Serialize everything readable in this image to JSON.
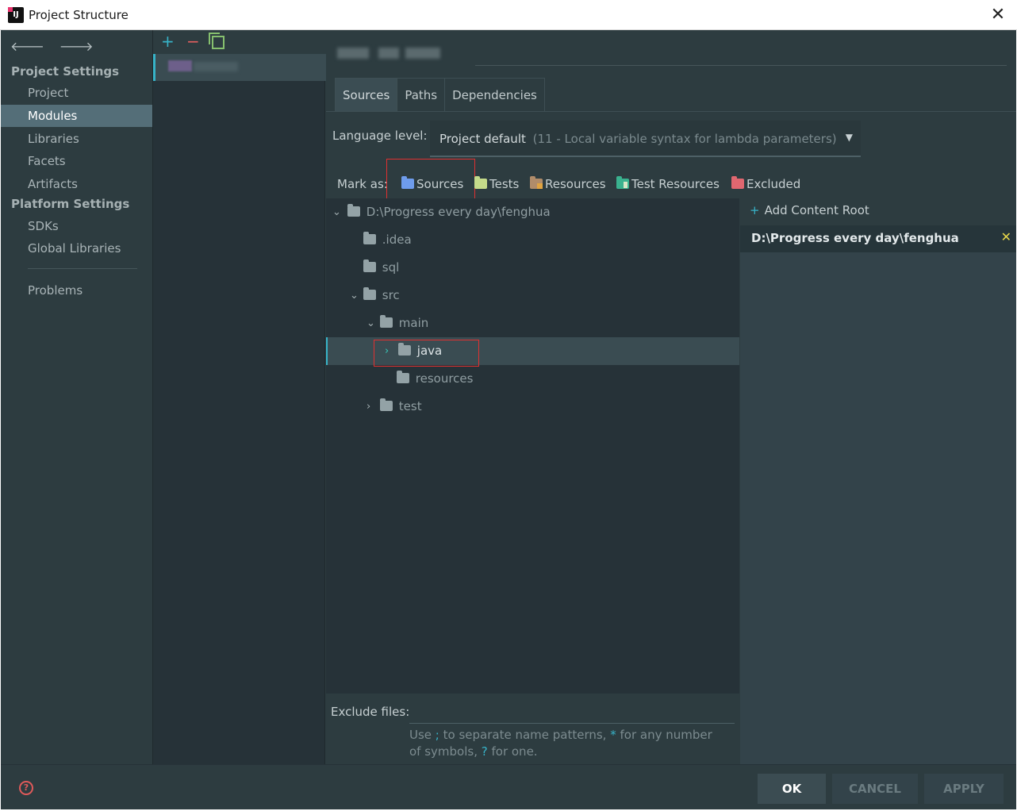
{
  "window": {
    "title": "Project Structure"
  },
  "nav": {
    "project_settings_header": "Project Settings",
    "platform_settings_header": "Platform Settings",
    "items": [
      {
        "label": "Project"
      },
      {
        "label": "Modules",
        "selected": true
      },
      {
        "label": "Libraries"
      },
      {
        "label": "Facets"
      },
      {
        "label": "Artifacts"
      },
      {
        "label": "SDKs"
      },
      {
        "label": "Global Libraries"
      },
      {
        "label": "Problems"
      }
    ]
  },
  "tabs": [
    {
      "label": "Sources",
      "active": true
    },
    {
      "label": "Paths"
    },
    {
      "label": "Dependencies"
    }
  ],
  "language_level": {
    "label": "Language level:",
    "value": "Project default",
    "detail": "(11 - Local variable syntax for lambda parameters)"
  },
  "mark_as": {
    "label": "Mark as:",
    "options": [
      "Sources",
      "Tests",
      "Resources",
      "Test Resources",
      "Excluded"
    ]
  },
  "tree": [
    {
      "label": "D:\\Progress every day\\fenghua",
      "expanded": true
    },
    {
      "label": ".idea"
    },
    {
      "label": "sql"
    },
    {
      "label": "src",
      "expanded": true
    },
    {
      "label": "main",
      "expanded": true
    },
    {
      "label": "java",
      "selected": true
    },
    {
      "label": "resources"
    },
    {
      "label": "test",
      "expanded": false
    }
  ],
  "content_root": {
    "add_label": "Add Content Root",
    "path": "D:\\Progress every day\\fenghua"
  },
  "exclude": {
    "label": "Exclude files:",
    "hint_pre": "Use ",
    "hint_sep": ";",
    "hint_mid": " to separate name patterns, ",
    "hint_star": "*",
    "hint_mid2": " for any number of symbols, ",
    "hint_q": "?",
    "hint_post": " for one."
  },
  "buttons": {
    "ok": "OK",
    "cancel": "CANCEL",
    "apply": "APPLY"
  },
  "colors": {
    "accent": "#37b3c8",
    "selected_nav": "#546e78",
    "background": "#2d3c40"
  }
}
